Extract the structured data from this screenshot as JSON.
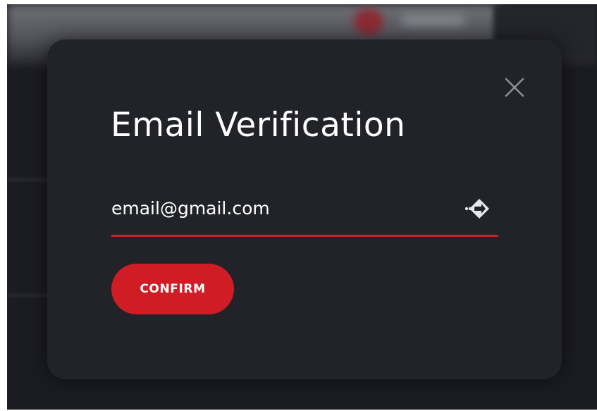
{
  "modal": {
    "title": "Email Verification",
    "email_value": "email@gmail.com",
    "email_placeholder": "",
    "confirm_label": "CONFIRM",
    "close_icon": "close-icon",
    "submit_icon": "arrow-right-icon"
  },
  "colors": {
    "accent": "#d01c25",
    "modal_bg": "#212329",
    "text": "#ffffff",
    "muted_icon": "#8b8d96"
  }
}
